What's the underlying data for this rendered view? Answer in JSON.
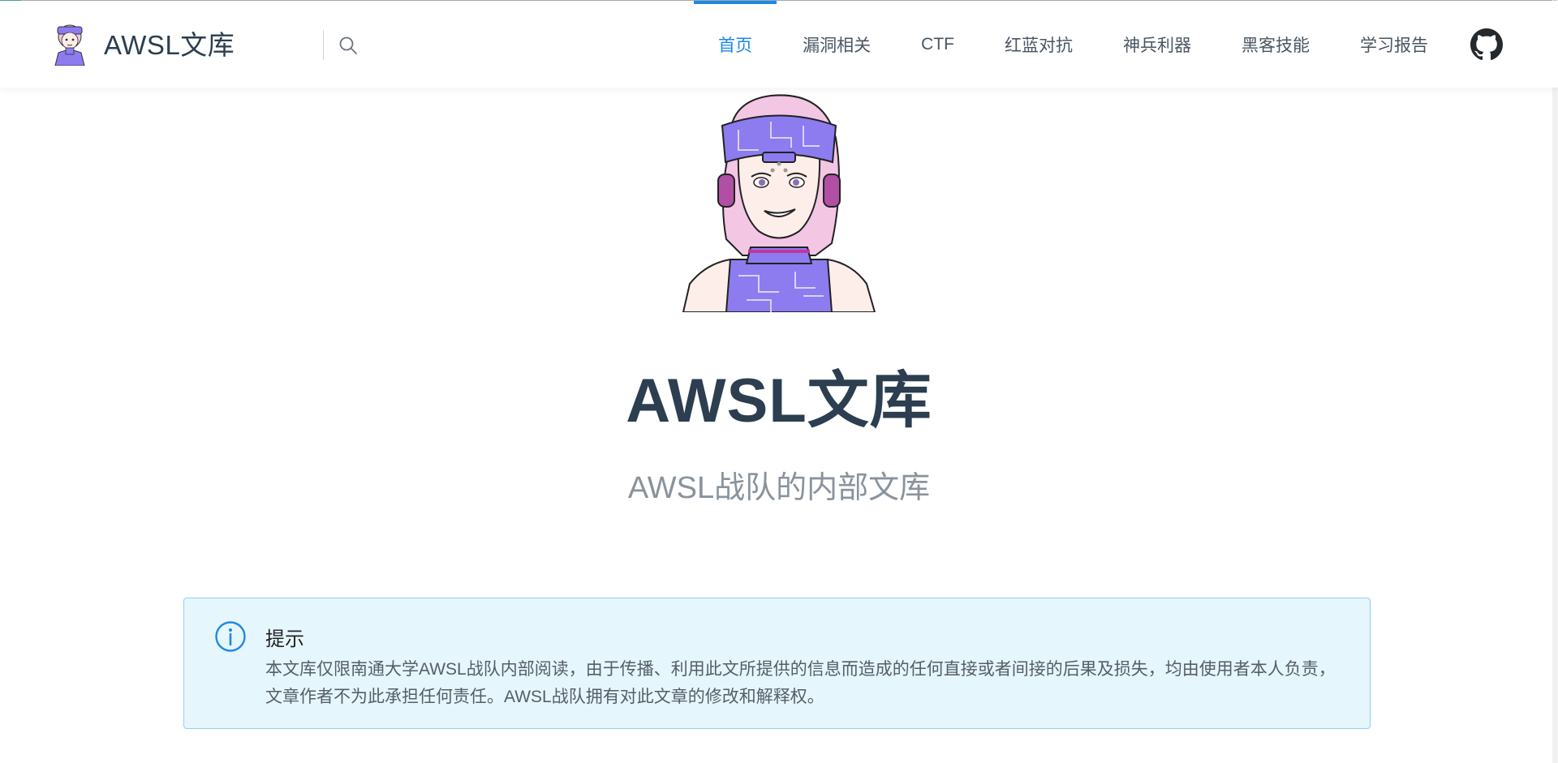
{
  "site": {
    "title": "AWSL文库"
  },
  "search": {
    "icon": "search-icon"
  },
  "nav": {
    "items": [
      {
        "label": "首页",
        "active": true
      },
      {
        "label": "漏洞相关",
        "active": false
      },
      {
        "label": "CTF",
        "active": false
      },
      {
        "label": "红蓝对抗",
        "active": false
      },
      {
        "label": "神兵利器",
        "active": false
      },
      {
        "label": "黑客技能",
        "active": false
      },
      {
        "label": "学习报告",
        "active": false
      }
    ],
    "github_icon": "github-icon"
  },
  "hero": {
    "title": "AWSL文库",
    "description": "AWSL战队的内部文库"
  },
  "tip": {
    "icon": "info-icon",
    "title": "提示",
    "content": "本文库仅限南通大学AWSL战队内部阅读，由于传播、利用此文所提供的信息而造成的任何直接或者间接的后果及损失，均由使用者本人负责，文章作者不为此承担任何责任。AWSL战队拥有对此文章的修改和解释权。"
  },
  "colors": {
    "accent": "#1e88e5",
    "progress": "#3eaf7c",
    "tip_background": "#e6f6fd",
    "tip_border": "#8fd0ec",
    "avatar_purple": "#8c7cf0",
    "avatar_hair": "#f3c6e4"
  }
}
